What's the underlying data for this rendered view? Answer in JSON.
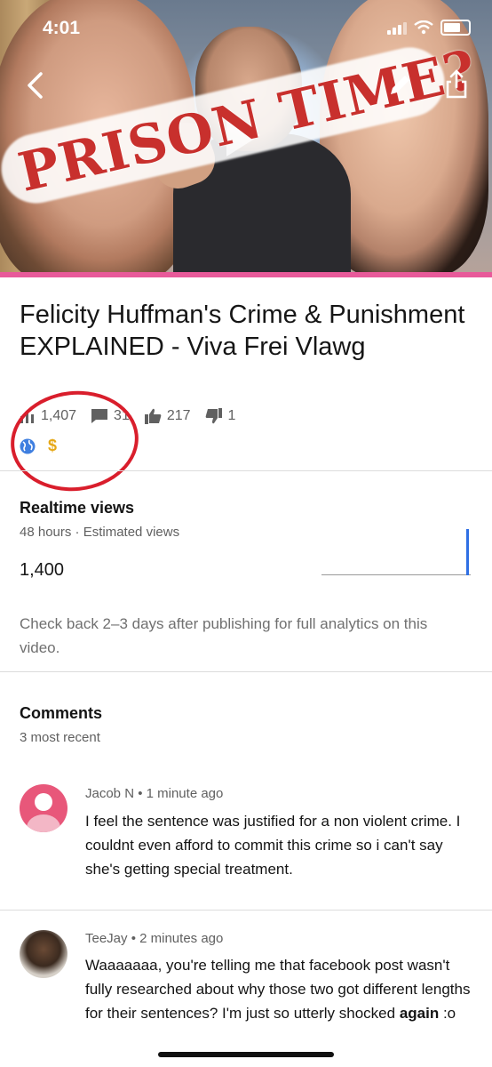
{
  "status_bar": {
    "time": "4:01"
  },
  "thumbnail": {
    "overlay_text": "PRISON TIME?",
    "accent_color": "#c8302d"
  },
  "video": {
    "title": "Felicity Huffman's Crime & Punishment EXPLAINED - Viva Frei Vlawg",
    "views": "1,407",
    "comments": "31",
    "likes": "217",
    "dislikes": "1",
    "monetization_icon": "$"
  },
  "realtime": {
    "title": "Realtime views",
    "subtitle": "48 hours · Estimated views",
    "value": "1,400",
    "note": "Check back 2–3 days after publishing for full analytics on this video."
  },
  "comments_section": {
    "title": "Comments",
    "subtitle": "3 most recent",
    "items": [
      {
        "author": "Jacob N",
        "time": "1 minute ago",
        "text": "I feel the sentence was justified for a non violent crime.  I couldnt even afford to commit this crime so i can't say she's getting special treatment."
      },
      {
        "author": "TeeJay",
        "time": "2 minutes ago",
        "text": "Waaaaaaa, you're telling me that facebook post wasn't fully researched about why those two got different lengths for their sentences? I'm just so utterly shocked",
        "text_bold": "again",
        "text_tail": " :o"
      }
    ]
  }
}
